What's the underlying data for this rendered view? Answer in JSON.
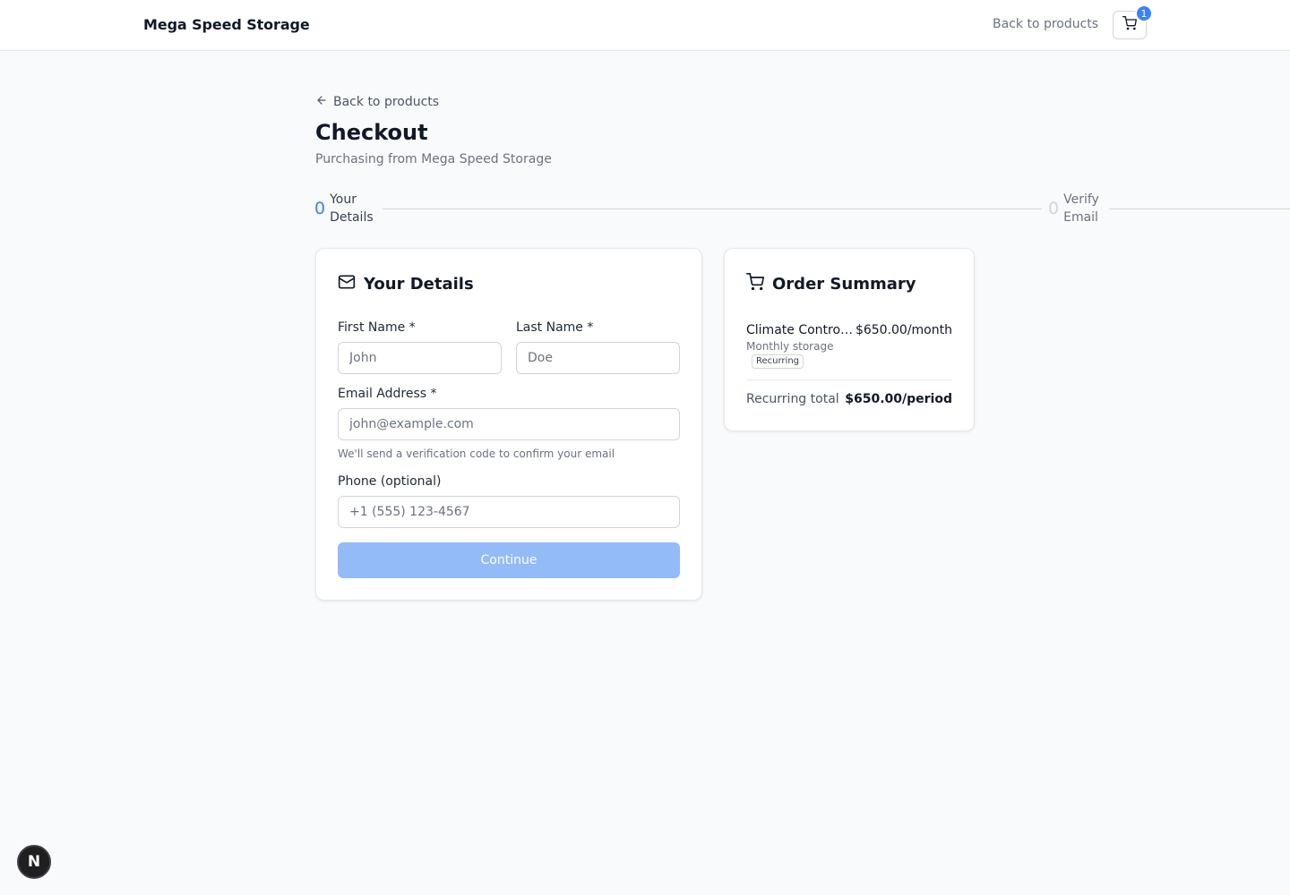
{
  "header": {
    "brand": "Mega Speed Storage",
    "back_link": "Back to products",
    "cart_count": "1"
  },
  "page": {
    "back_link": "Back to products",
    "title": "Checkout",
    "subtitle": "Purchasing from Mega Speed Storage"
  },
  "stepper": {
    "steps": [
      {
        "number": "0",
        "label": "Your Details",
        "state": "active"
      },
      {
        "number": "0",
        "label": "Verify Email",
        "state": "inactive"
      }
    ]
  },
  "details_form": {
    "title": "Your Details",
    "first_name": {
      "label": "First Name *",
      "placeholder": "John",
      "value": ""
    },
    "last_name": {
      "label": "Last Name *",
      "placeholder": "Doe",
      "value": ""
    },
    "email": {
      "label": "Email Address *",
      "placeholder": "john@example.com",
      "value": "",
      "help": "We'll send a verification code to confirm your email"
    },
    "phone": {
      "label": "Phone (optional)",
      "placeholder": "+1 (555) 123-4567",
      "value": ""
    },
    "continue_label": "Continue"
  },
  "order_summary": {
    "title": "Order Summary",
    "items": [
      {
        "name": "Climate Controlled Storage",
        "price": "$650.00/month",
        "description": "Monthly storage",
        "tag": "Recurring"
      }
    ],
    "total_label": "Recurring total",
    "total_value": "$650.00/period"
  },
  "floating_badge": "N",
  "colors": {
    "accent": "#3b82f6",
    "button_disabled": "#93bbf8",
    "border": "#e5e7eb",
    "background": "#f9fafb"
  }
}
